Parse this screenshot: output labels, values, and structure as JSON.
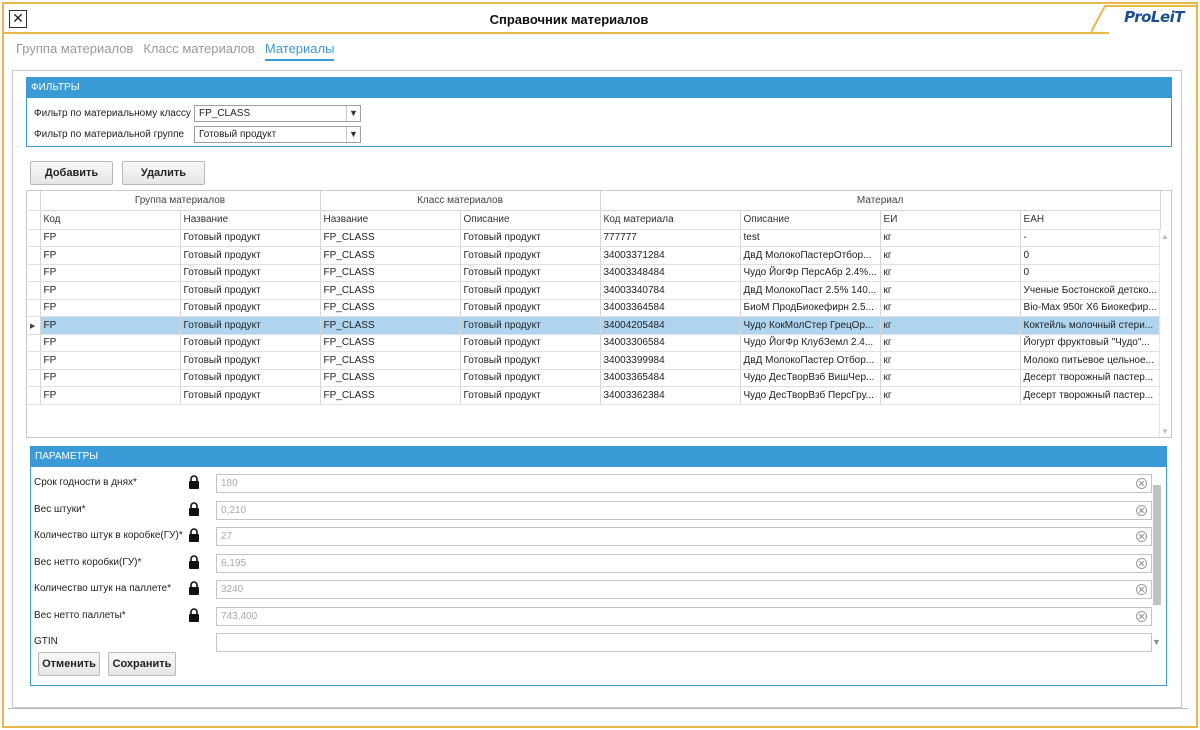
{
  "window": {
    "title": "Справочник материалов",
    "close_label": "✕",
    "logo": "ProLeiT"
  },
  "tabs": [
    {
      "label": "Группа материалов",
      "active": false
    },
    {
      "label": "Класс материалов",
      "active": false
    },
    {
      "label": "Материалы",
      "active": true
    }
  ],
  "filters": {
    "header": "ФИЛЬТРЫ",
    "class_filter": {
      "label": "Фильтр по материальному классу",
      "value": "FP_CLASS"
    },
    "group_filter": {
      "label": "Фильтр по материальной группе",
      "value": "Готовый продукт"
    }
  },
  "toolbar": {
    "add_label": "Добавить",
    "delete_label": "Удалить"
  },
  "grid": {
    "groups": {
      "group": "Группа материалов",
      "class": "Класс материалов",
      "material": "Материал"
    },
    "columns": [
      "Код",
      "Название",
      "Название",
      "Описание",
      "Код материала",
      "Описание",
      "ЕИ",
      "ЕАН"
    ],
    "rows": [
      [
        "FP",
        "Готовый продукт",
        "FP_CLASS",
        "Готовый продукт",
        "777777",
        "test",
        "кг",
        "-"
      ],
      [
        "FP",
        "Готовый продукт",
        "FP_CLASS",
        "Готовый продукт",
        "34003371284",
        "ДвД МолокоПастерОтбор...",
        "кг",
        "0"
      ],
      [
        "FP",
        "Готовый продукт",
        "FP_CLASS",
        "Готовый продукт",
        "34003348484",
        "Чудо ЙогФр ПерсАбр 2.4%...",
        "кг",
        "0"
      ],
      [
        "FP",
        "Готовый продукт",
        "FP_CLASS",
        "Готовый продукт",
        "34003340784",
        "ДвД МолокоПаст 2.5% 140...",
        "кг",
        "Ученые Бостонской детско..."
      ],
      [
        "FP",
        "Готовый продукт",
        "FP_CLASS",
        "Готовый продукт",
        "34003364584",
        "БиоМ ПродБиокефирн 2.5...",
        "кг",
        "Bio-Max 950г X6 Биокефир..."
      ],
      [
        "FP",
        "Готовый продукт",
        "FP_CLASS",
        "Готовый продукт",
        "34004205484",
        "Чудо КокМолСтер ГрецОр...",
        "кг",
        "Коктейль молочный стери..."
      ],
      [
        "FP",
        "Готовый продукт",
        "FP_CLASS",
        "Готовый продукт",
        "34003306584",
        "Чудо ЙогФр КлубЗемл 2.4...",
        "кг",
        "Йогурт фруктовый \"Чудо\"..."
      ],
      [
        "FP",
        "Готовый продукт",
        "FP_CLASS",
        "Готовый продукт",
        "34003399984",
        "ДвД МолокоПастер Отбор...",
        "кг",
        "Молоко питьевое цельное..."
      ],
      [
        "FP",
        "Готовый продукт",
        "FP_CLASS",
        "Готовый продукт",
        "34003365484",
        "Чудо ДесТворВзб ВишЧер...",
        "кг",
        "Десерт творожный пастер..."
      ],
      [
        "FP",
        "Готовый продукт",
        "FP_CLASS",
        "Готовый продукт",
        "34003362384",
        "Чудо ДесТворВзб ПерсГру...",
        "кг",
        "Десерт творожный пастер..."
      ]
    ],
    "selected_row": 5
  },
  "params": {
    "header": "ПАРАМЕТРЫ",
    "fields": [
      {
        "label": "Срок годности в днях*",
        "value": "180",
        "locked": true
      },
      {
        "label": "Вес штуки*",
        "value": "0,210",
        "locked": true
      },
      {
        "label": "Количество штук в коробке(ГУ)*",
        "value": "27",
        "locked": true
      },
      {
        "label": "Вес нетто коробки(ГУ)*",
        "value": "6,195",
        "locked": true
      },
      {
        "label": "Количество штук на паллете*",
        "value": "3240",
        "locked": true
      },
      {
        "label": "Вес нетто паллеты*",
        "value": "743,400",
        "locked": true
      },
      {
        "label": "GTIN",
        "value": "",
        "locked": false
      }
    ],
    "cancel_label": "Отменить",
    "save_label": "Сохранить"
  },
  "colors": {
    "accent": "#3a9bd6",
    "frame": "#e8b94a",
    "selected_row": "#aed4f0",
    "logo": "#1d4e8f"
  },
  "icons": {
    "lock": "lock-icon",
    "clear": "clear-icon",
    "close": "close-icon",
    "dropdown": "chevron-down-icon"
  }
}
